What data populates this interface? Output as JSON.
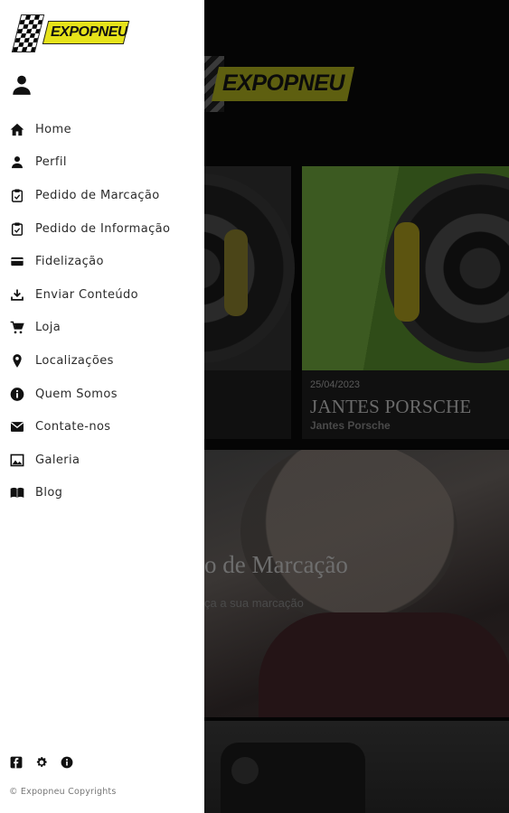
{
  "app": {
    "brand": "EXPOPNEU",
    "accent_color": "#e6e21a"
  },
  "background": {
    "card1": {},
    "card2": {
      "date": "25/04/2023",
      "title": "JANTES PORSCHE",
      "subtitle": "Jantes Porsche"
    },
    "banner": {
      "title": "o de Marcação",
      "subtitle": "ça a sua marcação"
    }
  },
  "drawer": {
    "profile_icon": "person-icon",
    "items": [
      {
        "label": "Home",
        "icon": "home-icon"
      },
      {
        "label": "Perfil",
        "icon": "person-icon"
      },
      {
        "label": "Pedido de Marcação",
        "icon": "clipboard-icon"
      },
      {
        "label": "Pedido de Informação",
        "icon": "clipboard-icon"
      },
      {
        "label": "Fidelização",
        "icon": "card-icon"
      },
      {
        "label": "Enviar Conteúdo",
        "icon": "upload-icon"
      },
      {
        "label": "Loja",
        "icon": "cart-icon"
      },
      {
        "label": "Localizações",
        "icon": "location-pin-icon"
      },
      {
        "label": "Quem Somos",
        "icon": "info-icon"
      },
      {
        "label": "Contate-nos",
        "icon": "mail-icon"
      },
      {
        "label": "Galeria",
        "icon": "image-icon"
      },
      {
        "label": "Blog",
        "icon": "book-icon"
      }
    ],
    "footer": {
      "icons": [
        "facebook-icon",
        "gear-icon",
        "info-icon"
      ],
      "copyright": "© Expopneu Copyrights"
    }
  }
}
